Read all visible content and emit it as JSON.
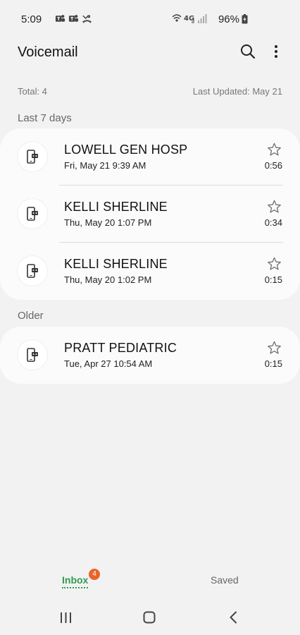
{
  "status": {
    "time": "5:09",
    "battery": "96%",
    "network": "4G"
  },
  "header": {
    "title": "Voicemail"
  },
  "summary": {
    "total": "Total: 4",
    "last_updated": "Last Updated: May 21"
  },
  "sections": {
    "last7": "Last 7 days",
    "older": "Older"
  },
  "voicemails": [
    {
      "name": "LOWELL GEN HOSP",
      "date": "Fri, May 21 9:39 AM",
      "duration": "0:56"
    },
    {
      "name": "KELLI SHERLINE",
      "date": "Thu, May 20 1:07 PM",
      "duration": "0:34"
    },
    {
      "name": "KELLI SHERLINE",
      "date": "Thu, May 20 1:02 PM",
      "duration": "0:15"
    },
    {
      "name": "PRATT PEDIATRIC",
      "date": "Tue, Apr 27 10:54 AM",
      "duration": "0:15"
    }
  ],
  "tabs": {
    "inbox": "Inbox",
    "inbox_badge": "4",
    "saved": "Saved"
  },
  "colors": {
    "accent": "#2e9b52",
    "badge": "#e8642b"
  }
}
